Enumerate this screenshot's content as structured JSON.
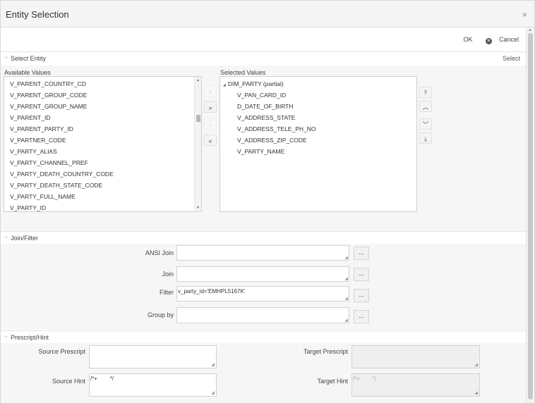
{
  "dialog": {
    "title": "Entity Selection",
    "close_glyph": "×",
    "ok_label": "OK",
    "cancel_label": "Cancel",
    "cancel_icon_glyph": "✕"
  },
  "select_entity": {
    "header": "Select Entity",
    "chevron_glyph": "⌵",
    "select_link": "Select",
    "available_label": "Available Values",
    "selected_label": "Selected Values",
    "available_values": [
      "V_PARENT_COUNTRY_CD",
      "V_PARENT_GROUP_CODE",
      "V_PARENT_GROUP_NAME",
      "V_PARENT_ID",
      "V_PARENT_PARTY_ID",
      "V_PARTNER_CODE",
      "V_PARTY_ALIAS",
      "V_PARTY_CHANNEL_PREF",
      "V_PARTY_DEATH_COUNTRY_CODE",
      "V_PARTY_DEATH_STATE_CODE",
      "V_PARTY_FULL_NAME",
      "V_PARTY_ID"
    ],
    "selected_tree": {
      "expand_glyph": "◢",
      "root": "DIM_PARTY (partial)",
      "children": [
        "V_PAN_CARD_ID",
        "D_DATE_OF_BIRTH",
        "V_ADDRESS_STATE",
        "V_ADDRESS_TELE_PH_NO",
        "V_ADDRESS_ZIP_CODE",
        "V_PARTY_NAME"
      ]
    },
    "move_buttons": {
      "move_one": "›",
      "move_all": "»",
      "remove_one": "‹",
      "remove_all": "«"
    },
    "order_buttons": {
      "top": "⤒",
      "up": "︿",
      "down": "﹀",
      "bottom": "⤓"
    }
  },
  "join_filter": {
    "header": "Join/Filter",
    "fields": [
      {
        "label": "ANSI Join",
        "value": ""
      },
      {
        "label": "Join",
        "value": ""
      },
      {
        "label": "Filter",
        "value": "v_party_id='EMHPL5167K'"
      },
      {
        "label": "Group by",
        "value": ""
      }
    ],
    "dots": "..."
  },
  "prescript_hint": {
    "header": "Prescript/Hint",
    "source_prescript_label": "Source Prescript",
    "target_prescript_label": "Target Prescript",
    "source_hint_label": "Source Hint",
    "source_hint_value": "/*+        */",
    "target_hint_label": "Target Hint",
    "target_hint_value": "/*+        */"
  },
  "icons": {
    "resize_grip": "◢",
    "scroll_up": "▲",
    "scroll_down": "▼"
  }
}
